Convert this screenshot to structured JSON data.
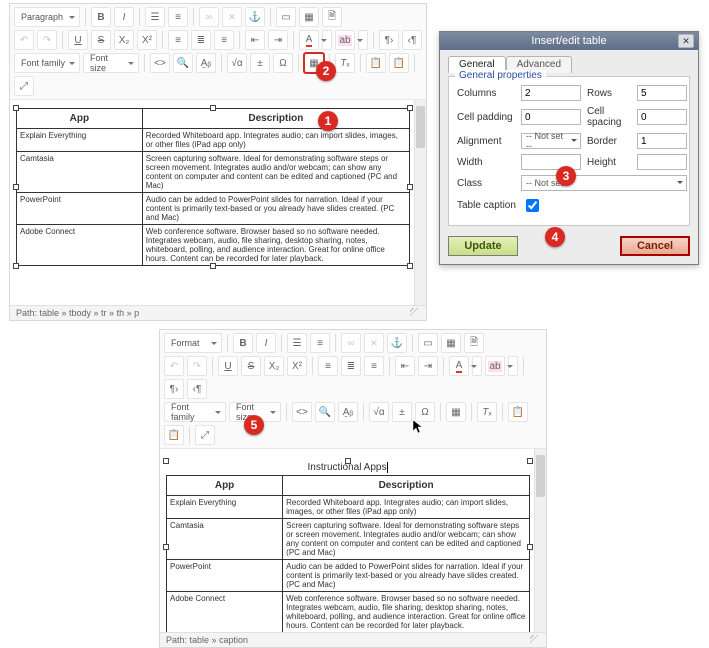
{
  "callouts": {
    "c1": "1",
    "c2": "2",
    "c3": "3",
    "c4": "4",
    "c5": "5"
  },
  "editor1": {
    "format_sel": "Paragraph",
    "fontfamily_sel": "Font family",
    "fontsize_sel": "Font size",
    "path": "Path: table » tbody » tr » th » p"
  },
  "editor2": {
    "format_sel": "Format",
    "fontfamily_sel": "Font family",
    "fontsize_sel": "Font size",
    "caption": "Instructional Apps",
    "path": "Path: table » caption"
  },
  "table": {
    "headers": {
      "col1": "App",
      "col2": "Description"
    },
    "rows": [
      {
        "app": "Explain Everything",
        "desc": "Recorded Whiteboard app. Integrates audio; can import slides, images, or other files (iPad app only)"
      },
      {
        "app": "Camtasia",
        "desc": "Screen capturing software. Ideal for demonstrating software steps or screen movement. Integrates audio and/or webcam; can show any content on computer and content can be edited and captioned (PC and Mac)"
      },
      {
        "app": "PowerPoint",
        "desc": "Audio can be added to PowerPoint slides for narration. Ideal if your content is primarily text-based or you already have slides created. (PC and Mac)"
      },
      {
        "app": "Adobe Connect",
        "desc": "Web conference software. Browser based so no software needed. Integrates webcam, audio, file sharing, desktop sharing, notes, whiteboard, polling, and audience interaction. Great for online office hours. Content can be recorded for later playback."
      }
    ]
  },
  "dialog": {
    "title": "Insert/edit table",
    "tabs": {
      "general": "General",
      "advanced": "Advanced"
    },
    "legend": "General properties",
    "labels": {
      "columns": "Columns",
      "rows": "Rows",
      "cellpadding": "Cell padding",
      "cellspacing": "Cell spacing",
      "alignment": "Alignment",
      "border": "Border",
      "width": "Width",
      "height": "Height",
      "class": "Class",
      "table_caption": "Table caption"
    },
    "values": {
      "columns": "2",
      "rows": "5",
      "cellpadding": "0",
      "cellspacing": "0",
      "alignment": "-- Not set --",
      "border": "1",
      "width": "",
      "height": "",
      "class": "-- Not set --",
      "caption_checked": true
    },
    "buttons": {
      "update": "Update",
      "cancel": "Cancel"
    }
  }
}
